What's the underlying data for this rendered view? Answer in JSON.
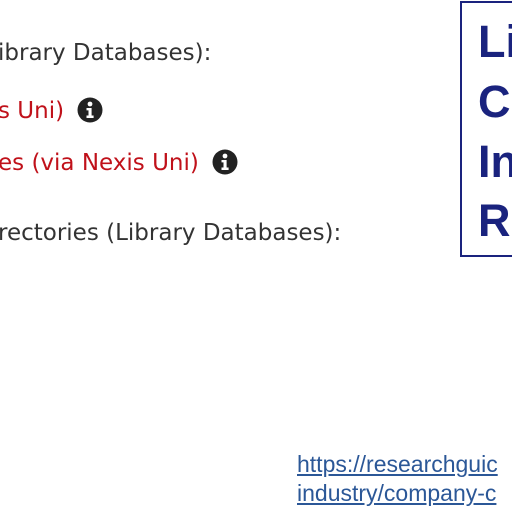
{
  "content": {
    "line1": "ibrary Databases):",
    "line2_link": "s Uni)",
    "line3_link": "es (via Nexis Uni)",
    "line4": "rectories (Library Databases):"
  },
  "callout": {
    "lines": [
      "Li",
      "Co",
      "In",
      "R"
    ]
  },
  "url": {
    "line1": "https://researchguic",
    "line2": "industry/company-c"
  },
  "colors": {
    "body_text": "#333333",
    "link_red": "#c0111a",
    "callout_navy": "#1a237e",
    "url_blue": "#2b5797"
  },
  "icons": {
    "info": "info-circle-icon"
  }
}
